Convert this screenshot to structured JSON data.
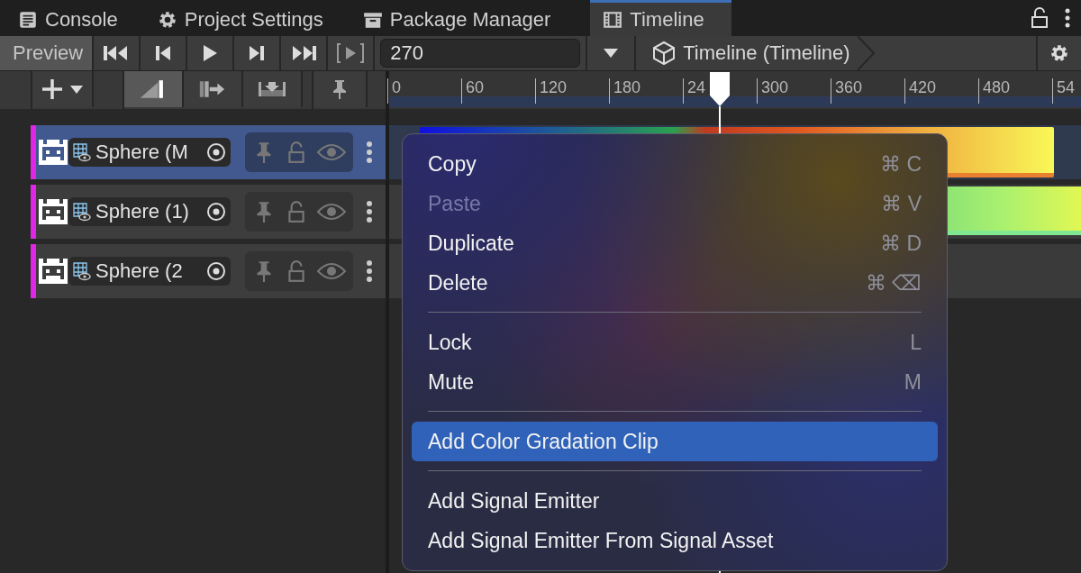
{
  "tabs": [
    {
      "kind": "console",
      "label": "Console",
      "selected": false
    },
    {
      "kind": "settings",
      "label": "Project Settings",
      "selected": false
    },
    {
      "kind": "package",
      "label": "Package Manager",
      "selected": false
    },
    {
      "kind": "timeline",
      "label": "Timeline",
      "selected": true
    }
  ],
  "toolbar": {
    "preview_label": "Preview",
    "frame_field": {
      "value": "270"
    },
    "breadcrumb": "Timeline (Timeline)"
  },
  "edit_modes": [
    {
      "kind": "mix",
      "selected": true
    },
    {
      "kind": "ripple",
      "selected": false
    },
    {
      "kind": "replace",
      "selected": false
    }
  ],
  "ruler": {
    "labels": [
      "0",
      "60",
      "120",
      "180",
      "24",
      "300",
      "360",
      "420",
      "480",
      "54"
    ]
  },
  "tracks": [
    {
      "name": "Sphere (M",
      "selected": true
    },
    {
      "name": "Sphere (1)",
      "selected": false
    },
    {
      "name": "Sphere (2",
      "selected": false
    }
  ],
  "menu": {
    "items": [
      {
        "kind": "item",
        "label": "Copy",
        "shortcut": "⌘ C",
        "disabled": false,
        "selected": false
      },
      {
        "kind": "item",
        "label": "Paste",
        "shortcut": "⌘ V",
        "disabled": true,
        "selected": false
      },
      {
        "kind": "item",
        "label": "Duplicate",
        "shortcut": "⌘ D",
        "disabled": false,
        "selected": false
      },
      {
        "kind": "item",
        "label": "Delete",
        "shortcut": "⌘ ⌫",
        "disabled": false,
        "selected": false
      },
      {
        "kind": "separator"
      },
      {
        "kind": "item",
        "label": "Lock",
        "shortcut": "L",
        "disabled": false,
        "selected": false
      },
      {
        "kind": "item",
        "label": "Mute",
        "shortcut": "M",
        "disabled": false,
        "selected": false
      },
      {
        "kind": "separator"
      },
      {
        "kind": "item",
        "label": "Add Color Gradation Clip",
        "disabled": false,
        "selected": true
      },
      {
        "kind": "separator"
      },
      {
        "kind": "item",
        "label": "Add Signal Emitter",
        "disabled": false,
        "selected": false
      },
      {
        "kind": "item",
        "label": "Add Signal Emitter From Signal Asset",
        "disabled": false,
        "selected": false
      }
    ]
  }
}
